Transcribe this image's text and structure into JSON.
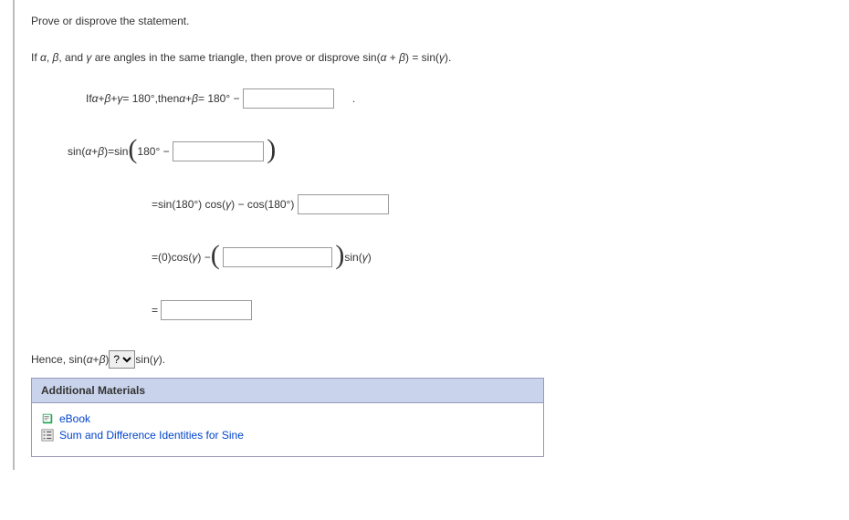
{
  "intro": {
    "prompt": "Prove or disprove the statement.",
    "statement_prefix": "If ",
    "alpha": "α",
    "beta": "β",
    "gamma": "γ",
    "statement_mid": ", and ",
    "statement_angles": " are angles in the same triangle, then prove or disprove  sin(",
    "plus": " + ",
    "statement_close1": ")",
    "eq": " = ",
    "statement_rhs": "sin(",
    "statement_close2": ")."
  },
  "line1": {
    "prefix": "If  ",
    "expr1_a": "α",
    "expr1_p1": " + ",
    "expr1_b": "β",
    "expr1_p2": " + ",
    "expr1_c": "γ",
    "expr1_eq": " = 180°,",
    "then": "  then  ",
    "expr2_a": "α",
    "expr2_p1": " + ",
    "expr2_b": "β",
    "expr2_eq": " = 180° − ",
    "period": " ."
  },
  "line2": {
    "lhs_a": "sin(",
    "lhs_alpha": "α",
    "lhs_plus": " + ",
    "lhs_beta": "β",
    "lhs_close": ")",
    "eq": "  =  ",
    "rhs_sin": "sin",
    "rhs_open": "(",
    "rhs_180": "180° − ",
    "rhs_close": ")"
  },
  "line3": {
    "eq": "=  ",
    "text1": "sin(180°) cos(",
    "gamma": "γ",
    "text2": ") − cos(180°) "
  },
  "line4": {
    "eq": "=  ",
    "text1": "(0)cos(",
    "gamma": "γ",
    "text2": ") − ",
    "open": "(",
    "close": ")",
    "sin": "sin(",
    "gamma2": "γ",
    "sinclose": ")"
  },
  "line5": {
    "eq": "=  "
  },
  "hence": {
    "prefix": "Hence,  sin(",
    "alpha": "α",
    "plus": " + ",
    "beta": "β",
    "close": ") ",
    "select_placeholder": "?",
    "suffix_sin": " sin(",
    "gamma": "γ",
    "suffix_close": ")."
  },
  "materials": {
    "header": "Additional Materials",
    "link1": "eBook",
    "link2": "Sum and Difference Identities for Sine"
  }
}
